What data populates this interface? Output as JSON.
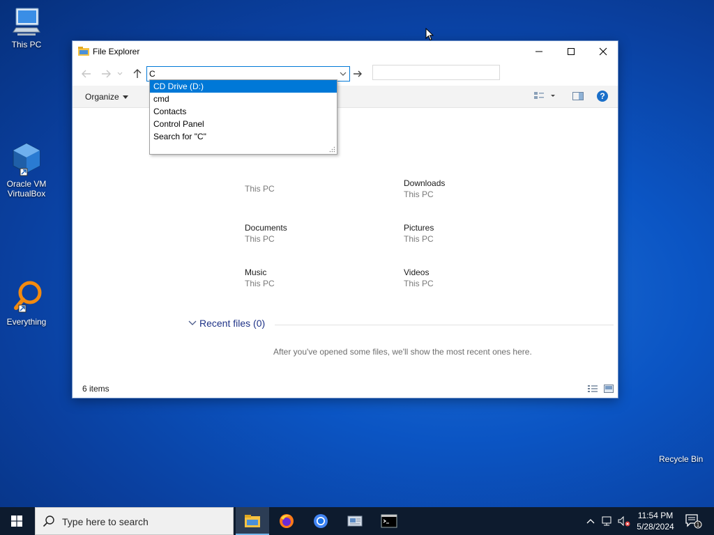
{
  "desktop": {
    "icons": [
      {
        "label": "This PC",
        "icon": "monitor-icon"
      },
      {
        "label": "Oracle VM\nVirtualBox",
        "icon": "virtualbox-icon"
      },
      {
        "label": "Everything",
        "icon": "everything-search-icon"
      }
    ],
    "recycle_bin_label": "Recycle Bin"
  },
  "window": {
    "title": "File Explorer",
    "address_value": "C",
    "search_placeholder": "",
    "toolbar": {
      "organize_label": "Organize"
    },
    "autocomplete": [
      {
        "label": "CD Drive (D:)",
        "selected": true
      },
      {
        "label": "cmd",
        "selected": false
      },
      {
        "label": "Contacts",
        "selected": false
      },
      {
        "label": "Control Panel",
        "selected": false
      },
      {
        "label": "Search for \"C\"",
        "selected": false
      }
    ],
    "folders": [
      {
        "name": "",
        "location": "This PC"
      },
      {
        "name": "Downloads",
        "location": "This PC"
      },
      {
        "name": "Documents",
        "location": "This PC"
      },
      {
        "name": "Pictures",
        "location": "This PC"
      },
      {
        "name": "Music",
        "location": "This PC"
      },
      {
        "name": "Videos",
        "location": "This PC"
      }
    ],
    "recent": {
      "header": "Recent files (0)",
      "message": "After you've opened some files, we'll show the most recent ones here."
    },
    "status": {
      "item_count": "6 items"
    }
  },
  "taskbar": {
    "search_placeholder": "Type here to search",
    "apps": [
      "file-explorer-icon",
      "firefox-icon",
      "chrome-icon",
      "app-icon",
      "terminal-icon"
    ],
    "clock": {
      "time": "11:54 PM",
      "date": "5/28/2024"
    },
    "notification_count": "1"
  },
  "colors": {
    "accent": "#0078d7",
    "taskbar": "#0d1b2e",
    "link": "#1e3287"
  }
}
